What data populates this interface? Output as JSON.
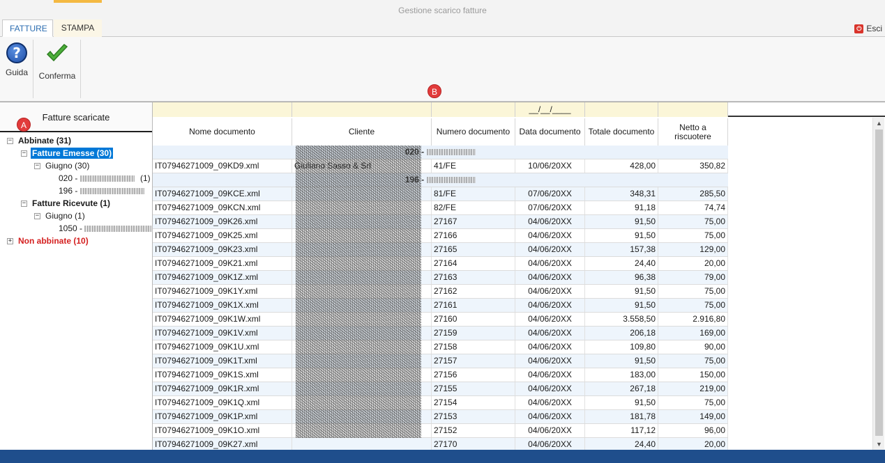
{
  "window": {
    "title": "Gestione scarico fatture"
  },
  "tabs": [
    {
      "label": "FATTURE"
    },
    {
      "label": "STAMPA"
    }
  ],
  "esci": {
    "label": "Esci"
  },
  "ribbon": {
    "guida_label": "Guida",
    "conferma_label": "Conferma"
  },
  "markers": {
    "a": "A",
    "b": "B"
  },
  "left_panel": {
    "title": "Fatture scaricate",
    "tree": {
      "abbinate": {
        "label": "Abbinate",
        "count": "(31)"
      },
      "emesse": {
        "label": "Fatture Emesse",
        "count": "(30)"
      },
      "giugno_emesse": {
        "label": "Giugno",
        "count": "(30)"
      },
      "item_020": {
        "label": "020 -",
        "count": "(1)"
      },
      "item_196": {
        "label": "196 -"
      },
      "ricevute": {
        "label": "Fatture Ricevute",
        "count": "(1)"
      },
      "giugno_ricevute": {
        "label": "Giugno",
        "count": "(1)"
      },
      "item_1050": {
        "label": "1050 -"
      },
      "non_abbinate": {
        "label": "Non abbinate",
        "count": "(10)"
      }
    }
  },
  "grid": {
    "filter_date": "__/__/____",
    "columns": [
      "Nome documento",
      "Cliente",
      "Numero documento",
      "Data documento",
      "Totale documento",
      "Netto a riscuotere"
    ],
    "groups": [
      {
        "label": "020 -"
      },
      {
        "label": "196 -"
      }
    ],
    "rows": [
      {
        "nome": "IT07946271009_09KD9.xml",
        "cliente": "Giuliano Sasso & Srl",
        "numero": "41/FE",
        "data": "10/06/20XX",
        "totale": "428,00",
        "netto": "350,82"
      },
      {
        "nome": "IT07946271009_09KCE.xml",
        "cliente": "",
        "numero": "81/FE",
        "data": "07/06/20XX",
        "totale": "348,31",
        "netto": "285,50"
      },
      {
        "nome": "IT07946271009_09KCN.xml",
        "cliente": "",
        "numero": "82/FE",
        "data": "07/06/20XX",
        "totale": "91,18",
        "netto": "74,74"
      },
      {
        "nome": "IT07946271009_09K26.xml",
        "cliente": "",
        "numero": "27167",
        "data": "04/06/20XX",
        "totale": "91,50",
        "netto": "75,00"
      },
      {
        "nome": "IT07946271009_09K25.xml",
        "cliente": "",
        "numero": "27166",
        "data": "04/06/20XX",
        "totale": "91,50",
        "netto": "75,00"
      },
      {
        "nome": "IT07946271009_09K23.xml",
        "cliente": "",
        "numero": "27165",
        "data": "04/06/20XX",
        "totale": "157,38",
        "netto": "129,00"
      },
      {
        "nome": "IT07946271009_09K21.xml",
        "cliente": "",
        "numero": "27164",
        "data": "04/06/20XX",
        "totale": "24,40",
        "netto": "20,00"
      },
      {
        "nome": "IT07946271009_09K1Z.xml",
        "cliente": "",
        "numero": "27163",
        "data": "04/06/20XX",
        "totale": "96,38",
        "netto": "79,00"
      },
      {
        "nome": "IT07946271009_09K1Y.xml",
        "cliente": "",
        "numero": "27162",
        "data": "04/06/20XX",
        "totale": "91,50",
        "netto": "75,00"
      },
      {
        "nome": "IT07946271009_09K1X.xml",
        "cliente": "",
        "numero": "27161",
        "data": "04/06/20XX",
        "totale": "91,50",
        "netto": "75,00"
      },
      {
        "nome": "IT07946271009_09K1W.xml",
        "cliente": "",
        "numero": "27160",
        "data": "04/06/20XX",
        "totale": "3.558,50",
        "netto": "2.916,80"
      },
      {
        "nome": "IT07946271009_09K1V.xml",
        "cliente": "",
        "numero": "27159",
        "data": "04/06/20XX",
        "totale": "206,18",
        "netto": "169,00"
      },
      {
        "nome": "IT07946271009_09K1U.xml",
        "cliente": "",
        "numero": "27158",
        "data": "04/06/20XX",
        "totale": "109,80",
        "netto": "90,00"
      },
      {
        "nome": "IT07946271009_09K1T.xml",
        "cliente": "",
        "numero": "27157",
        "data": "04/06/20XX",
        "totale": "91,50",
        "netto": "75,00"
      },
      {
        "nome": "IT07946271009_09K1S.xml",
        "cliente": "",
        "numero": "27156",
        "data": "04/06/20XX",
        "totale": "183,00",
        "netto": "150,00"
      },
      {
        "nome": "IT07946271009_09K1R.xml",
        "cliente": "",
        "numero": "27155",
        "data": "04/06/20XX",
        "totale": "267,18",
        "netto": "219,00"
      },
      {
        "nome": "IT07946271009_09K1Q.xml",
        "cliente": "",
        "numero": "27154",
        "data": "04/06/20XX",
        "totale": "91,50",
        "netto": "75,00"
      },
      {
        "nome": "IT07946271009_09K1P.xml",
        "cliente": "",
        "numero": "27153",
        "data": "04/06/20XX",
        "totale": "181,78",
        "netto": "149,00"
      },
      {
        "nome": "IT07946271009_09K1O.xml",
        "cliente": "",
        "numero": "27152",
        "data": "04/06/20XX",
        "totale": "117,12",
        "netto": "96,00"
      },
      {
        "nome": "IT07946271009_09K27.xml",
        "cliente": "",
        "numero": "27170",
        "data": "04/06/20XX",
        "totale": "24,40",
        "netto": "20,00"
      }
    ]
  },
  "colors": {
    "accent": "#0078d7",
    "status_bar": "#1f4e8c",
    "filter_bg": "#fbf6d8",
    "marker": "#e23b3b"
  },
  "icons": {
    "guida": "help-icon",
    "conferma": "checkmark-icon",
    "esci": "exit-icon"
  }
}
